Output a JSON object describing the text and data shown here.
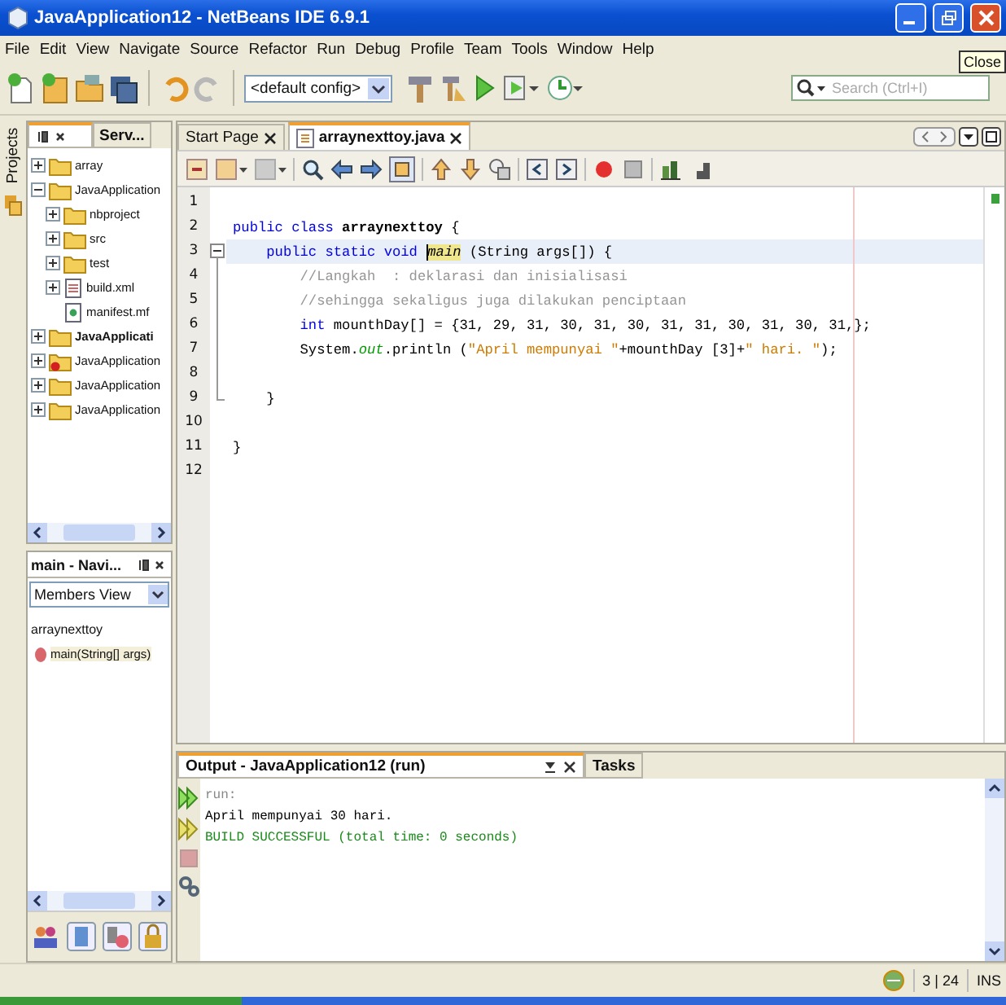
{
  "window": {
    "title": "JavaApplication12 - NetBeans IDE 6.9.1"
  },
  "tooltip": "Close",
  "menu": [
    "File",
    "Edit",
    "View",
    "Navigate",
    "Source",
    "Refactor",
    "Run",
    "Debug",
    "Profile",
    "Team",
    "Tools",
    "Window",
    "Help"
  ],
  "toolbar": {
    "config": "<default config>",
    "search_placeholder": "Search (Ctrl+I)"
  },
  "side_tabs": [
    "Projects"
  ],
  "projects": {
    "tabs": [
      {
        "selected": true
      },
      {
        "label": "Serv...",
        "selected": false
      }
    ],
    "tree": [
      {
        "label": "array",
        "kind": "folder",
        "expanded": false
      },
      {
        "label": "JavaApplication",
        "kind": "folder",
        "expanded": true,
        "children": [
          {
            "label": "nbproject",
            "kind": "folder",
            "expanded": false
          },
          {
            "label": "src",
            "kind": "folder",
            "expanded": false
          },
          {
            "label": "test",
            "kind": "folder",
            "expanded": false
          },
          {
            "label": "build.xml",
            "kind": "xml",
            "expanded": false
          },
          {
            "label": "manifest.mf",
            "kind": "file"
          }
        ]
      },
      {
        "label": "JavaApplicati",
        "kind": "folder",
        "expanded": false,
        "bold": true
      },
      {
        "label": "JavaApplication",
        "kind": "folder",
        "expanded": false,
        "error": true
      },
      {
        "label": "JavaApplication",
        "kind": "folder",
        "expanded": false
      },
      {
        "label": "JavaApplication",
        "kind": "folder",
        "expanded": false
      }
    ]
  },
  "navigator": {
    "title": "main - Navi...",
    "view": "Members View",
    "tree": [
      {
        "label": "arraynexttoy",
        "children": [
          {
            "label": "main(String[] args)",
            "kind": "method"
          }
        ]
      }
    ]
  },
  "editor": {
    "tabs": [
      {
        "label": "Start Page",
        "selected": false
      },
      {
        "label": "arraynexttoy.java",
        "selected": true
      }
    ],
    "lines": [
      {
        "number": "1",
        "kind": "plain",
        "current": false
      },
      {
        "number": "2",
        "kind": "plain",
        "current": false,
        "segments": [
          {
            "kind": "kw",
            "text": "public class"
          },
          {
            "kind": "cls",
            "text": " arraynexttoy"
          },
          {
            "kind": "plain",
            "text": " {"
          }
        ]
      },
      {
        "number": "3",
        "kind": "fold-start",
        "current": true,
        "segments": [
          {
            "kind": "kw",
            "text": "    public static void "
          },
          {
            "kind": "mark",
            "text": "main"
          },
          {
            "kind": "plain",
            "text": " (String args[]) {"
          }
        ]
      },
      {
        "number": "4",
        "kind": "fold-body",
        "current": false,
        "segments": [
          {
            "kind": "comment",
            "text": "        //Langkah  : deklarasi dan inisialisasi"
          }
        ]
      },
      {
        "number": "5",
        "kind": "fold-body",
        "current": false,
        "segments": [
          {
            "kind": "comment",
            "text": "        //sehingga sekaligus juga dilakukan penciptaan"
          }
        ]
      },
      {
        "number": "6",
        "kind": "fold-body",
        "current": false,
        "segments": [
          {
            "kind": "kw",
            "text": "        int"
          },
          {
            "kind": "plain",
            "text": " mounthDay[] = {31, 29, 31, 30, 31, 30, 31, 31, 30, 31, 30, 31,};"
          }
        ]
      },
      {
        "number": "7",
        "kind": "fold-body",
        "current": false,
        "segments": [
          {
            "kind": "plain",
            "text": "        System."
          },
          {
            "kind": "field",
            "text": "out"
          },
          {
            "kind": "plain",
            "text": ".println ("
          },
          {
            "kind": "str",
            "text": "\"April mempunyai \""
          },
          {
            "kind": "plain",
            "text": "+mounthDay [3]+"
          },
          {
            "kind": "str",
            "text": "\" hari. \""
          },
          {
            "kind": "plain",
            "text": ");"
          }
        ]
      },
      {
        "number": "8",
        "kind": "fold-body",
        "current": false
      },
      {
        "number": "9",
        "kind": "fold-end",
        "current": false,
        "segments": [
          {
            "kind": "plain",
            "text": "    }"
          }
        ]
      },
      {
        "number": "10",
        "kind": "plain",
        "current": false
      },
      {
        "number": "11",
        "kind": "plain",
        "current": false,
        "segments": [
          {
            "kind": "plain",
            "text": "}"
          }
        ]
      },
      {
        "number": "12",
        "kind": "plain",
        "current": false
      }
    ]
  },
  "output": {
    "tabs": [
      {
        "label": "Output - JavaApplication12 (run)",
        "selected": true
      },
      {
        "label": "Tasks",
        "selected": false
      }
    ],
    "lines": [
      {
        "kind": "info",
        "text": "run:"
      },
      {
        "kind": "plain",
        "text": "April mempunyai 30 hari."
      },
      {
        "kind": "success",
        "text": "BUILD SUCCESSFUL (total time: 0 seconds)"
      }
    ]
  },
  "status_bar": {
    "position": "3 | 24",
    "mode": "INS"
  }
}
